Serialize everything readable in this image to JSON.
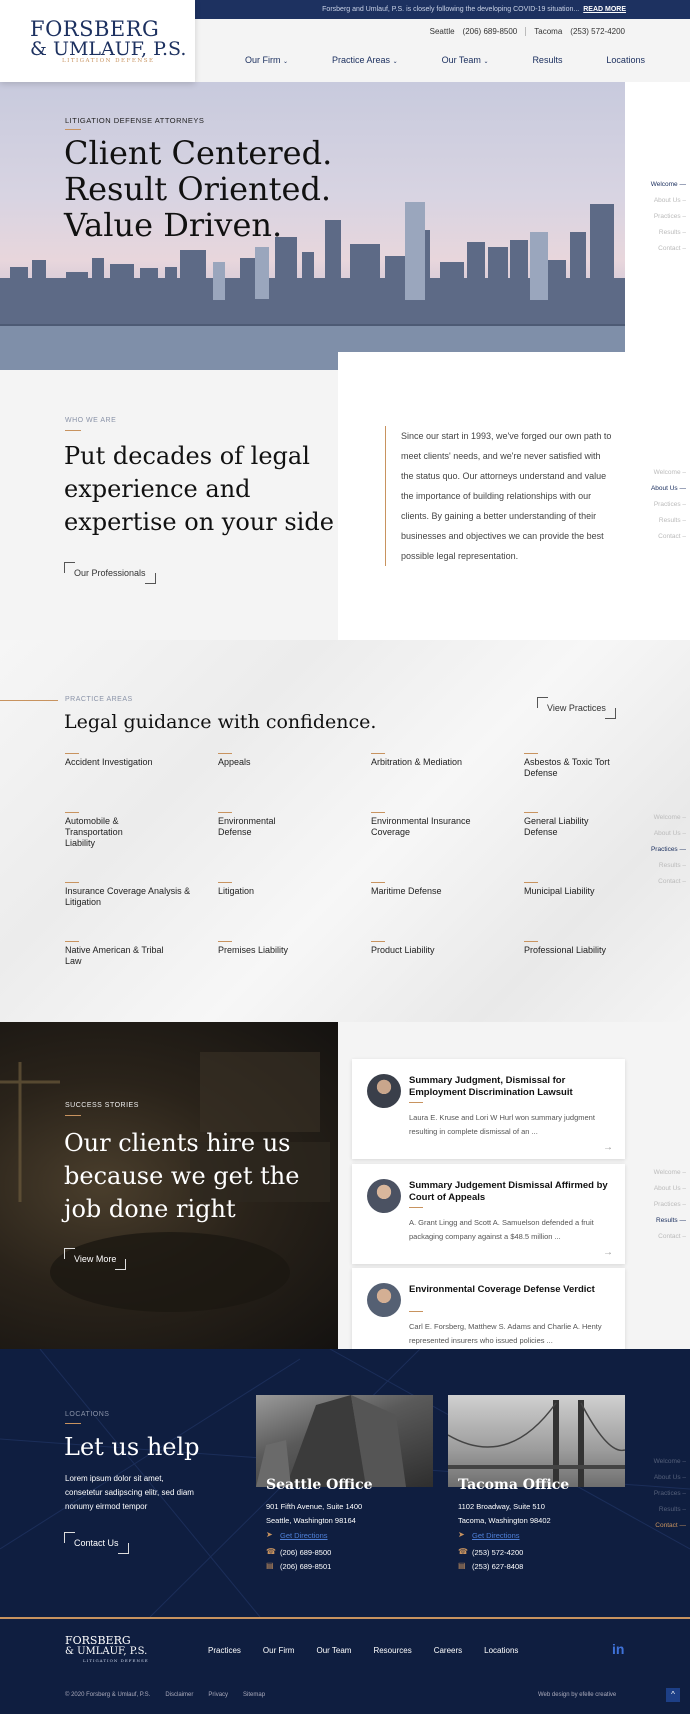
{
  "topbar": {
    "message": "Forsberg and Umlauf, P.S. is closely following the developing COVID-19 situation...",
    "read_more": "READ MORE"
  },
  "logo": {
    "line1": "FORSBERG",
    "line2": "& UMLAUF, P.S.",
    "line3": "LITIGATION DEFENSE"
  },
  "header": {
    "seattle_label": "Seattle",
    "seattle_phone": "(206) 689-8500",
    "tacoma_label": "Tacoma",
    "tacoma_phone": "(253) 572-4200"
  },
  "nav": [
    {
      "label": "Our Firm",
      "dropdown": true
    },
    {
      "label": "Practice Areas",
      "dropdown": true
    },
    {
      "label": "Our Team",
      "dropdown": true
    },
    {
      "label": "Results",
      "dropdown": false
    },
    {
      "label": "Locations",
      "dropdown": false
    }
  ],
  "hero": {
    "eyebrow": "LITIGATION DEFENSE ATTORNEYS",
    "line1": "Client Centered.",
    "line2": "Result Oriented.",
    "line3": "Value Driven."
  },
  "sidenav": [
    "Welcome",
    "About Us",
    "Practices",
    "Results",
    "Contact"
  ],
  "who": {
    "eyebrow": "WHO WE ARE",
    "title_line1": "Put decades of legal",
    "title_line2": "experience and",
    "title_line3": "expertise on your side",
    "button": "Our Professionals",
    "text": "Since our start in 1993, we've forged our own path to meet clients' needs, and we're never satisfied with the status quo. Our attorneys understand and value the importance of building relationships with our clients. By gaining a better understanding of their businesses and objectives we can provide the best possible legal representation."
  },
  "practices": {
    "eyebrow": "PRACTICE AREAS",
    "title": "Legal guidance with confidence.",
    "button": "View Practices",
    "items": [
      "Accident Investigation",
      "Appeals",
      "Arbitration & Mediation",
      "Asbestos & Toxic Tort Defense",
      "Automobile & Transportation Liability",
      "Environmental Defense",
      "Environmental Insurance Coverage",
      "General Liability Defense",
      "Insurance Coverage Analysis & Litigation",
      "Litigation",
      "Maritime Defense",
      "Municipal Liability",
      "Native American & Tribal Law",
      "Premises Liability",
      "Product Liability",
      "Professional Liability"
    ]
  },
  "success": {
    "eyebrow": "SUCCESS STORIES",
    "title_line1": "Our clients hire us",
    "title_line2": "because we get the",
    "title_line3": "job done right",
    "button": "View More",
    "stories": [
      {
        "title": "Summary Judgment, Dismissal for Employment Discrimination Lawsuit",
        "text": "Laura E. Kruse and Lori W Hurl won summary judgment resulting in complete dismissal of an ..."
      },
      {
        "title": "Summary Judgement Dismissal Affirmed by Court of Appeals",
        "text": "A. Grant Lingg and Scott A. Samuelson defended a fruit packaging company against a $48.5 million ..."
      },
      {
        "title": "Environmental Coverage Defense Verdict",
        "text": "Carl E. Forsberg, Matthew S. Adams and Charlie A. Henty represented insurers who issued policies ..."
      }
    ]
  },
  "locations": {
    "eyebrow": "LOCATIONS",
    "title": "Let us help",
    "text": "Lorem ipsum dolor sit amet, consetetur sadipscing elitr, sed diam nonumy eirmod tempor",
    "button": "Contact Us",
    "offices": [
      {
        "name": "Seattle Office",
        "street": "901 Fifth Avenue, Suite 1400",
        "city": "Seattle, Washington 98164",
        "directions": "Get Directions",
        "phone": "(206) 689-8500",
        "fax": "(206) 689-8501"
      },
      {
        "name": "Tacoma Office",
        "street": "1102 Broadway, Suite 510",
        "city": "Tacoma, Washington 98402",
        "directions": "Get Directions",
        "phone": "(253) 572-4200",
        "fax": "(253) 627-8408"
      }
    ]
  },
  "footer": {
    "nav": [
      "Practices",
      "Our Firm",
      "Our Team",
      "Resources",
      "Careers",
      "Locations"
    ],
    "linkedin": "in",
    "copyright": "© 2020 Forsberg & Umlauf, P.S.",
    "disclaimer": "Disclaimer",
    "privacy": "Privacy",
    "sitemap": "Sitemap",
    "credit": "Web design by efelle creative",
    "to_top": "^"
  },
  "colors": {
    "navy": "#1d3160",
    "gold": "#c8935f",
    "dark_navy": "#0f1e40"
  }
}
